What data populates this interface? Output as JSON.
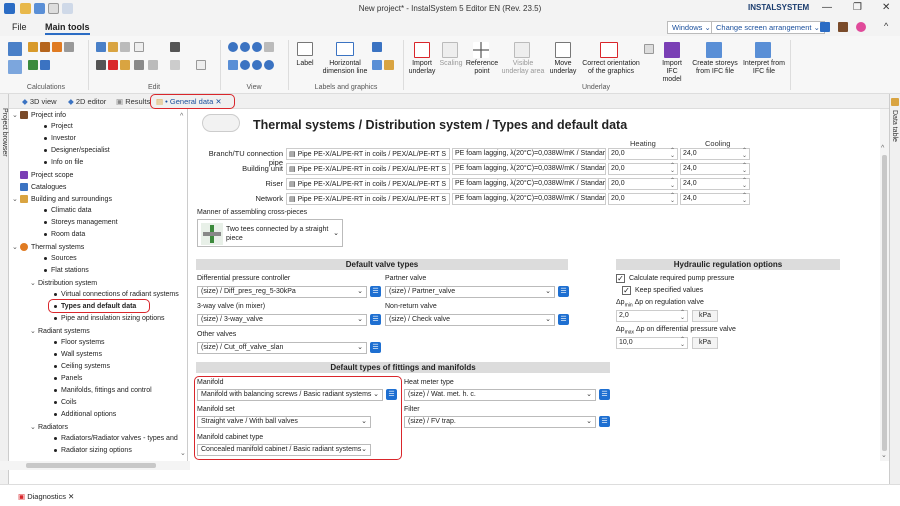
{
  "window": {
    "title": "New project* - InstalSystem 5 Editor EN (Rev. 23.5)",
    "brand": "INSTALSYSTEM",
    "brand_color": "#1a3c6e"
  },
  "menu": {
    "file": "File",
    "main_tools": "Main tools",
    "workspace_dd": "Windows",
    "arrangement_dd": "Change screen arrangement"
  },
  "ribbon": {
    "groups": {
      "calculations": "Calculations",
      "edit": "Edit",
      "view": "View",
      "labels": "Labels and graphics",
      "underlay": "Underlay"
    },
    "buttons": {
      "label": "Label",
      "horizontal_dimension_line": "Horizontal dimension line",
      "import_underlay": "Import underlay",
      "scaling": "Scaling",
      "reference_point": "Reference point",
      "visible_underlay_area": "Visible underlay area",
      "move_underlay": "Move underlay",
      "correct_orientation": "Correct orientation of the graphics",
      "import_ifc_model": "Import IFC model",
      "create_storeys": "Create storeys from IFC file",
      "interpret_ifc": "Interpret from IFC file"
    }
  },
  "doc_tabs": {
    "view_3d": "3D view",
    "editor_2d": "2D editor",
    "results": "Results",
    "general_data": "General data"
  },
  "side_tabs": {
    "project_browser": "Project browser",
    "data_table": "Data table"
  },
  "tree": {
    "project_info": "Project info",
    "project": "Project",
    "investor": "Investor",
    "designer": "Designer/specialist",
    "info_on_file": "Info on file",
    "project_scope": "Project scope",
    "catalogues": "Catalogues",
    "building": "Building and surroundings",
    "climatic": "Climatic data",
    "storeys": "Storeys management",
    "room": "Room data",
    "thermal": "Thermal systems",
    "sources": "Sources",
    "flat_stations": "Flat stations",
    "distribution": "Distribution system",
    "virtual_conn": "Virtual connections of radiant systems",
    "types_default": "Types and default data",
    "pipe_sizing": "Pipe and insulation sizing options",
    "radiant": "Radiant systems",
    "floor": "Floor systems",
    "wall": "Wall systems",
    "ceiling": "Ceiling systems",
    "panels": "Panels",
    "manifolds": "Manifolds, fittings and control",
    "coils": "Coils",
    "additional": "Additional options",
    "radiators": "Radiators",
    "radiator_valves": "Radiators/Radiator valves - types and",
    "radiator_sizing": "Radiator sizing options"
  },
  "main": {
    "heading": "Thermal systems / Distribution system / Types and default data",
    "col_heating": "Heating",
    "col_cooling": "Cooling",
    "rows": [
      {
        "label": "Branch/TU connection pipe",
        "pipe": "Pipe PE-X/AL/PE-RT in coils / PEX/AL/PE-RT S",
        "lagging": "PE foam lagging, λ(20°C)=0,038W/mK / Standar",
        "heating": "20,0",
        "cooling": "24,0"
      },
      {
        "label": "Building unit",
        "pipe": "Pipe PE-X/AL/PE-RT in coils / PEX/AL/PE-RT S",
        "lagging": "PE foam lagging, λ(20°C)=0,038W/mK / Standar",
        "heating": "20,0",
        "cooling": "24,0"
      },
      {
        "label": "Riser",
        "pipe": "Pipe PE-X/AL/PE-RT in coils / PEX/AL/PE-RT S",
        "lagging": "PE foam lagging, λ(20°C)=0,038W/mK / Standar",
        "heating": "20,0",
        "cooling": "24,0"
      },
      {
        "label": "Network",
        "pipe": "Pipe PE-X/AL/PE-RT in coils / PEX/AL/PE-RT S",
        "lagging": "PE foam lagging, λ(20°C)=0,038W/mK / Standar",
        "heating": "20,0",
        "cooling": "24,0"
      }
    ],
    "manner_label": "Manner of assembling cross-pieces",
    "manner_value": "Two tees connected by a straight piece",
    "valve_types": {
      "title": "Default valve types",
      "diff_pressure_label": "Differential pressure controller",
      "diff_pressure_value": "(size) / Diff_pres_reg_5-30kPa",
      "partner_label": "Partner valve",
      "partner_value": "(size) / Partner_valve",
      "three_way_label": "3-way valve (in mixer)",
      "three_way_value": "(size) / 3-way_valve",
      "non_return_label": "Non-return valve",
      "non_return_value": "(size) / Check valve",
      "other_label": "Other valves",
      "other_value": "(size) / Cut_off_valve_slan"
    },
    "hydraulic": {
      "title": "Hydraulic regulation options",
      "calc_pump": "Calculate required pump pressure",
      "keep_values": "Keep specified values",
      "dp_min_label": "Δp on regulation valve",
      "dp_min_sub": "min",
      "dp_min_value": "2,0",
      "dp_max_label": "Δp on differential pressure valve",
      "dp_max_sub": "max",
      "dp_max_value": "10,0",
      "unit": "kPa"
    },
    "fittings": {
      "title": "Default types of fittings and manifolds",
      "manifold_label": "Manifold",
      "manifold_value": "Manifold with balancing screws / Basic radiant systems",
      "heat_meter_label": "Heat meter type",
      "heat_meter_value": "(size) / Wat. met. h. c.",
      "manifold_set_label": "Manifold set",
      "manifold_set_value": "Straight valve / With ball valves",
      "filter_label": "Filter",
      "filter_value": "(size) / FV trap.",
      "cabinet_label": "Manifold cabinet type",
      "cabinet_value": "Concealed manifold cabinet / Basic radiant systems"
    }
  },
  "status": {
    "diagnostics": "Diagnostics"
  },
  "colors": {
    "highlight": "#d9262b",
    "accent_blue": "#1e6fd1",
    "section_bar": "#dcdcdc"
  }
}
